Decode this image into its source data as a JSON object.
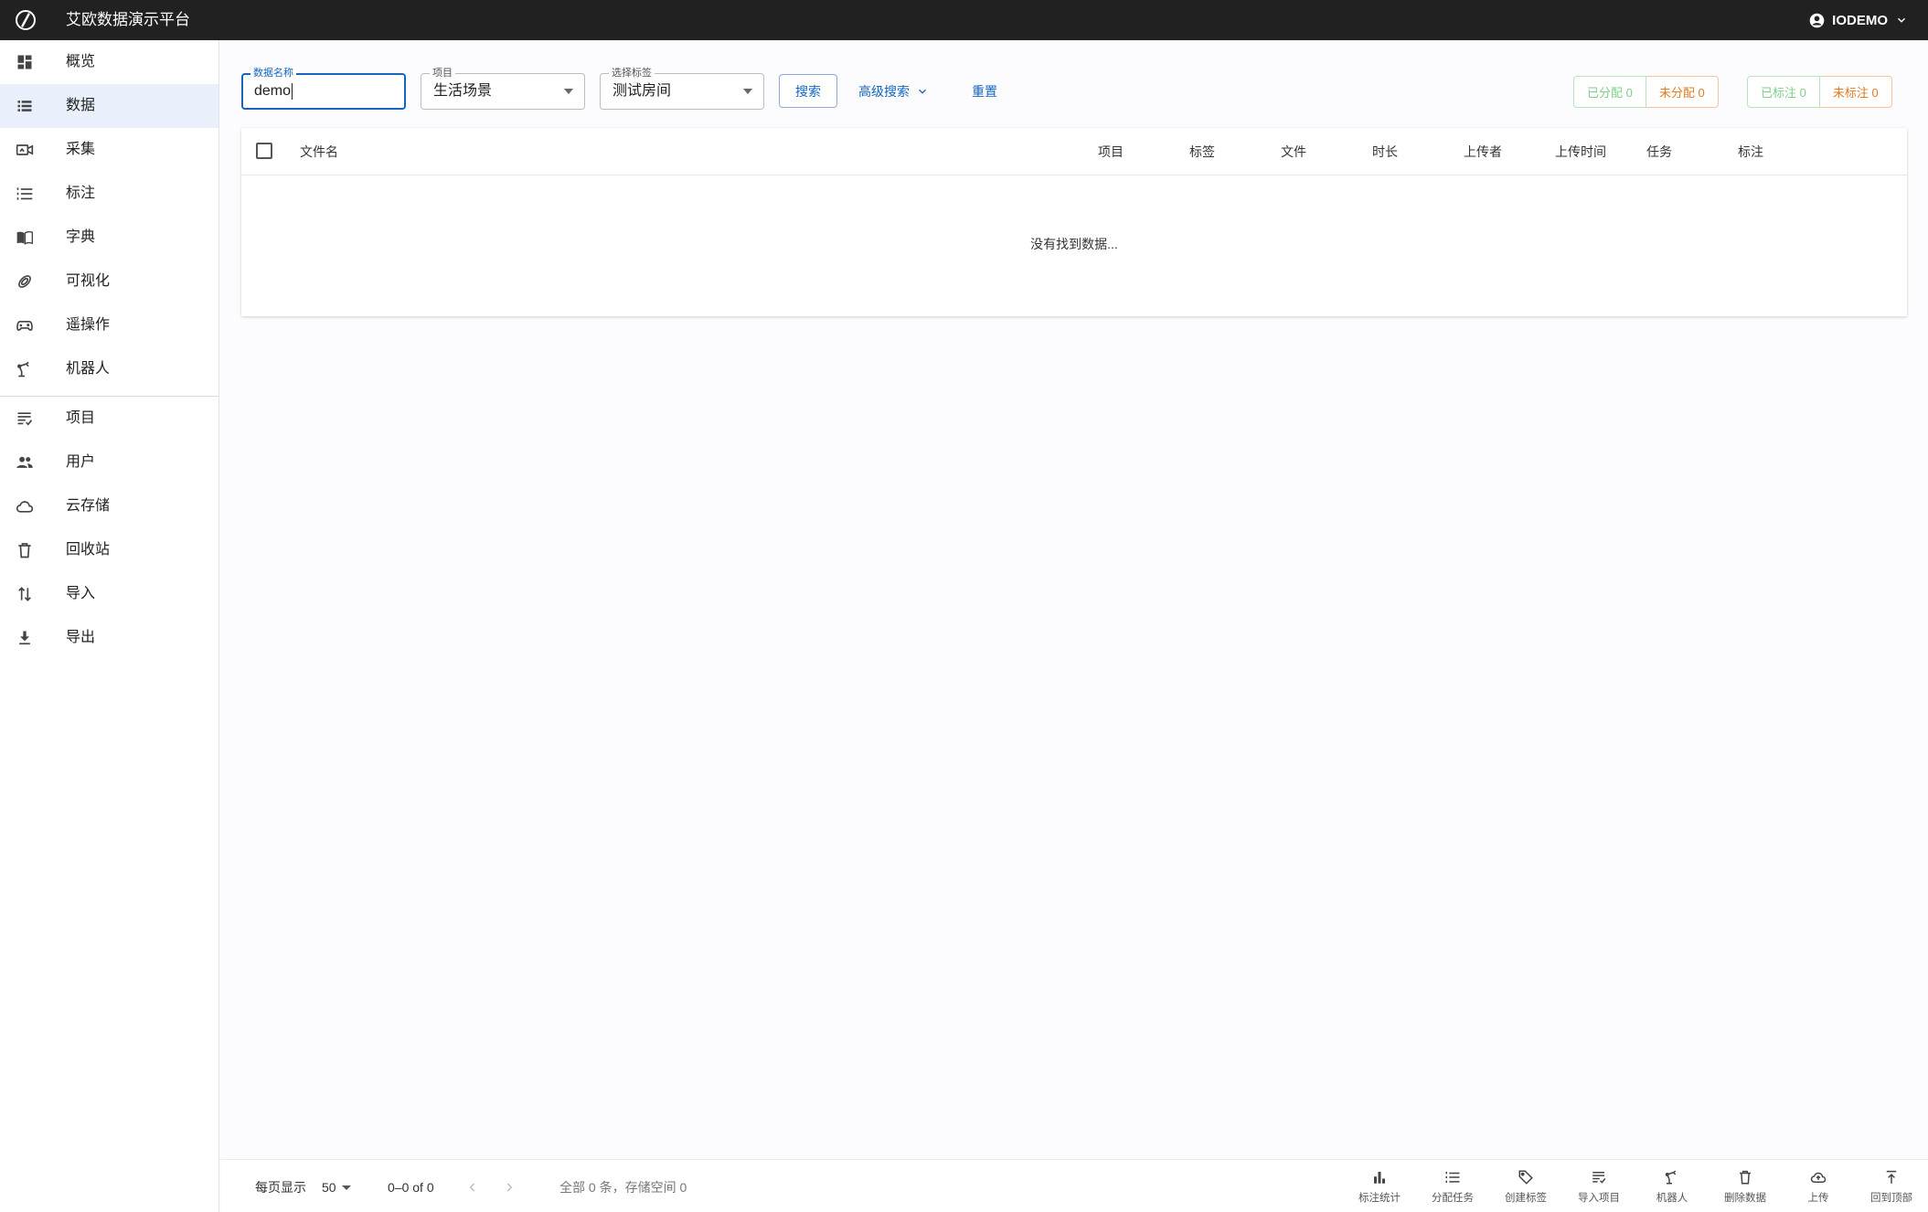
{
  "app": {
    "title": "艾欧数据演示平台",
    "user": "IODEMO"
  },
  "sidebar": {
    "items": [
      {
        "label": "概览",
        "icon": "dashboard-icon"
      },
      {
        "label": "数据",
        "icon": "list-icon",
        "active": true
      },
      {
        "label": "采集",
        "icon": "video-camera-icon"
      },
      {
        "label": "标注",
        "icon": "numbered-list-icon"
      },
      {
        "label": "字典",
        "icon": "book-icon"
      },
      {
        "label": "可视化",
        "icon": "rings-icon"
      },
      {
        "label": "遥操作",
        "icon": "gamepad-icon"
      },
      {
        "label": "机器人",
        "icon": "robot-arm-icon"
      },
      {
        "label": "项目",
        "icon": "checklist-icon"
      },
      {
        "label": "用户",
        "icon": "people-icon"
      },
      {
        "label": "云存储",
        "icon": "cloud-icon"
      },
      {
        "label": "回收站",
        "icon": "trash-icon"
      },
      {
        "label": "导入",
        "icon": "swap-vertical-icon"
      },
      {
        "label": "导出",
        "icon": "download-icon"
      }
    ]
  },
  "filters": {
    "name": {
      "label": "数据名称",
      "value": "demo"
    },
    "project": {
      "label": "项目",
      "value": "生活场景"
    },
    "tag": {
      "label": "选择标签",
      "value": "测试房间"
    },
    "search_label": "搜索",
    "advanced_label": "高级搜索",
    "reset_label": "重置"
  },
  "stats": {
    "assigned": "已分配 0",
    "unassigned": "未分配 0",
    "labeled": "已标注 0",
    "unlabeled": "未标注 0"
  },
  "table": {
    "columns": [
      "文件名",
      "项目",
      "标签",
      "文件",
      "时长",
      "上传者",
      "上传时间",
      "任务",
      "标注"
    ],
    "empty_message": "没有找到数据..."
  },
  "footer": {
    "per_page_label": "每页显示",
    "per_page_value": "50",
    "range": "0–0 of 0",
    "summary": "全部 0 条，存储空间 0",
    "actions": [
      {
        "label": "标注统计",
        "icon": "bar-chart-icon"
      },
      {
        "label": "分配任务",
        "icon": "list-icon"
      },
      {
        "label": "创建标签",
        "icon": "tag-icon"
      },
      {
        "label": "导入项目",
        "icon": "checklist-icon"
      },
      {
        "label": "机器人",
        "icon": "robot-arm-icon"
      },
      {
        "label": "删除数据",
        "icon": "trash-icon"
      },
      {
        "label": "上传",
        "icon": "cloud-upload-icon"
      },
      {
        "label": "回到顶部",
        "icon": "arrow-to-top-icon"
      }
    ]
  },
  "colors": {
    "topbar": "#212121",
    "accent": "#1565c0",
    "success": "#7ccf8a",
    "warning": "#e07b1f",
    "active_nav": "#eaf0fb"
  }
}
